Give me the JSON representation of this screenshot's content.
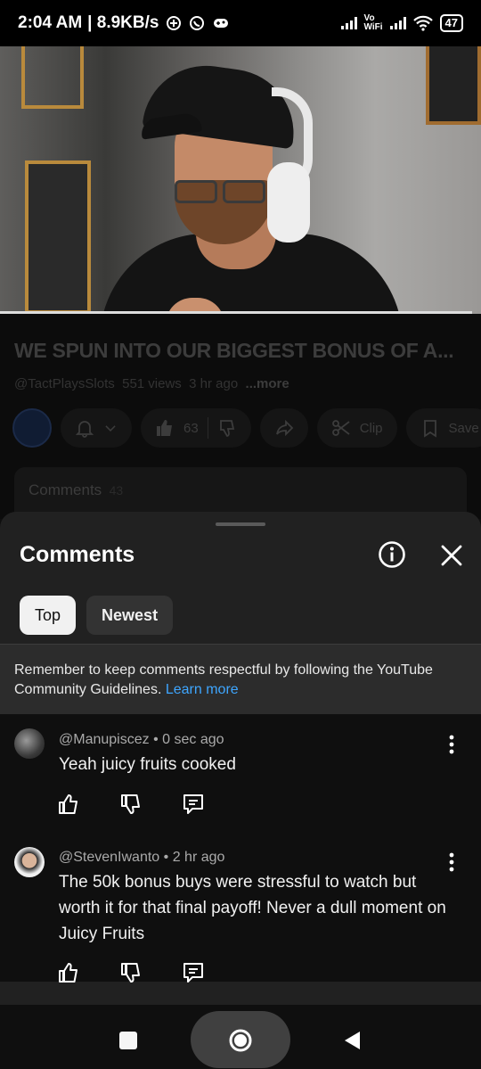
{
  "status_bar": {
    "time": "2:04 AM",
    "speed": "| 8.9KB/s",
    "vowifi_line1": "Vo",
    "vowifi_line2": "WiFi",
    "battery": "47"
  },
  "video_page": {
    "title": "WE SPUN INTO OUR BIGGEST BONUS OF A...",
    "channel": "@TactPlaysSlots",
    "views": "551 views",
    "age": "3 hr ago",
    "more": "...more",
    "like_count": "63",
    "clip_label": "Clip",
    "save_label": "Save",
    "comments_label": "Comments",
    "comments_count": "43"
  },
  "sheet": {
    "title": "Comments",
    "tabs": [
      {
        "label": "Top",
        "active": true
      },
      {
        "label": "Newest",
        "active": false
      }
    ],
    "notice_text": "Remember to keep comments respectful by following the YouTube Community Guidelines.",
    "notice_link": "Learn more"
  },
  "comments": [
    {
      "author": "@Manupiscez",
      "time": "0 sec ago",
      "text": "Yeah juicy fruits cooked"
    },
    {
      "author": "@StevenIwanto",
      "time": "2 hr ago",
      "text": "The 50k bonus buys were stressful to watch but worth it for that final payoff! Never a dull moment on Juicy Fruits"
    }
  ],
  "separator": " • ",
  "colors": {
    "accent_link": "#3ea6ff",
    "sheet_bg": "#212121",
    "page_bg": "#0f0f0f"
  },
  "icons": {
    "info": "info-icon",
    "close": "close-icon",
    "like": "thumbs-up-icon",
    "dislike": "thumbs-down-icon",
    "reply": "reply-icon",
    "more": "more-vertical-icon"
  }
}
